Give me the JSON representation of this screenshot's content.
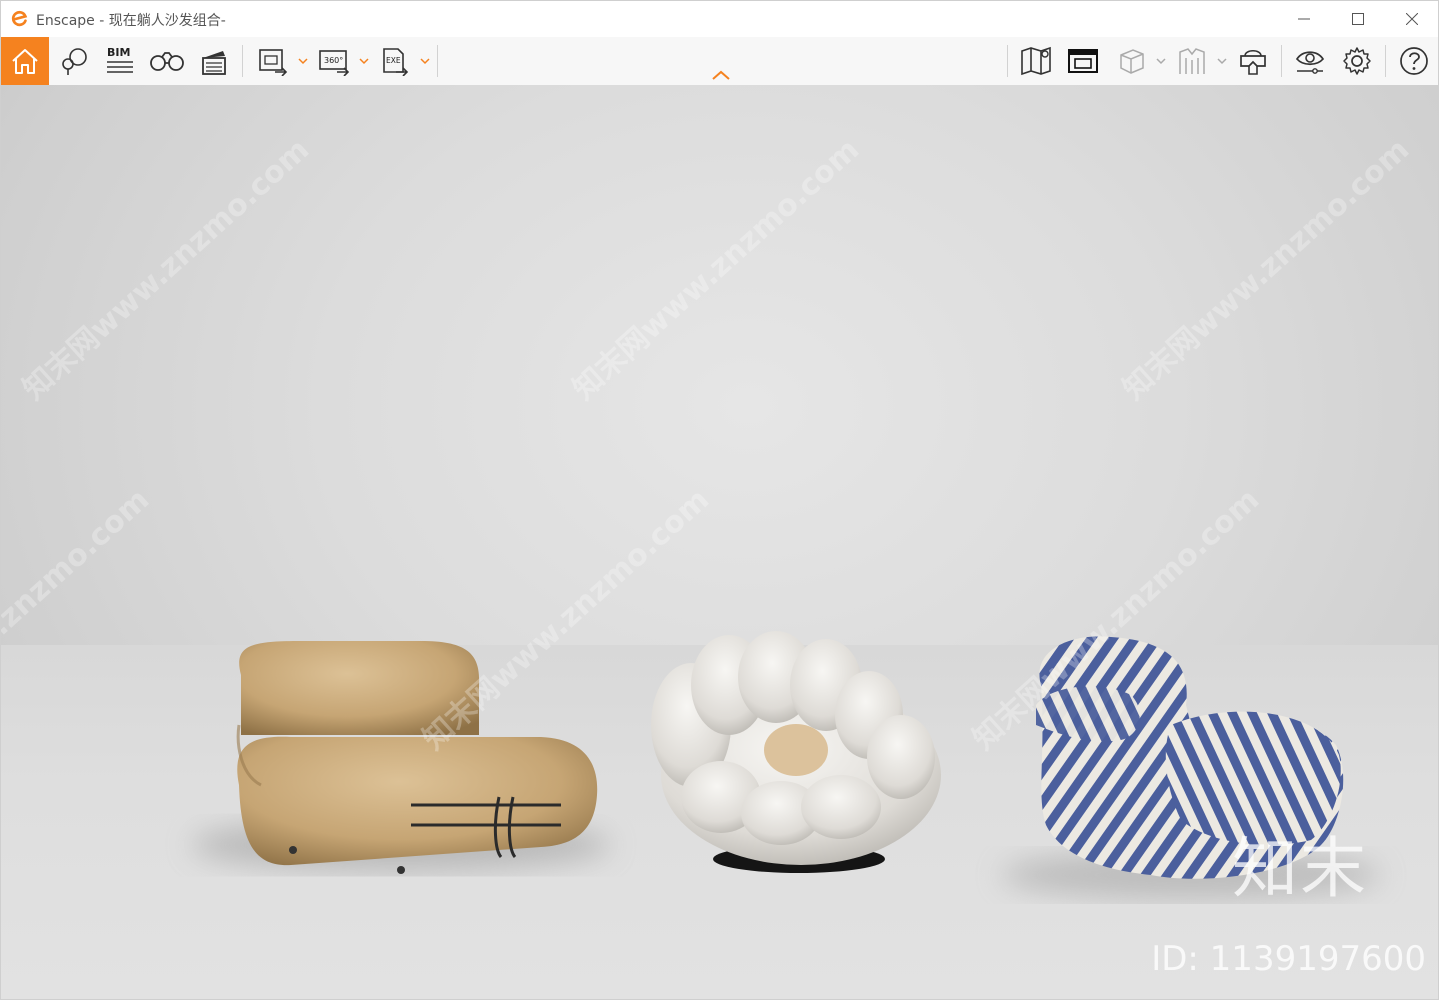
{
  "window": {
    "app_name": "Enscape",
    "title_suffix": " - 现在躺人沙发组合-",
    "accent_color": "#f5821f"
  },
  "window_controls": {
    "minimize_icon": "minimize-icon",
    "maximize_icon": "maximize-icon",
    "close_icon": "close-icon"
  },
  "toolbar": {
    "left_tools": [
      {
        "name": "home",
        "icon": "home-icon",
        "active": true
      },
      {
        "name": "views",
        "icon": "map-pin-icon"
      },
      {
        "name": "bim",
        "label": "BIM",
        "icon": "bim-icon"
      },
      {
        "name": "binoculars",
        "icon": "binoculars-icon"
      },
      {
        "name": "video-editor",
        "icon": "clapperboard-icon"
      },
      {
        "name": "screenshot-export",
        "icon": "image-export-icon"
      },
      {
        "name": "panorama-export",
        "label": "360°",
        "icon": "panorama-export-icon"
      },
      {
        "name": "exe-export",
        "label": "EXE",
        "icon": "exe-export-icon"
      }
    ],
    "right_tools": [
      {
        "name": "map",
        "icon": "map-icon"
      },
      {
        "name": "asset-library",
        "icon": "asset-library-icon"
      },
      {
        "name": "section-box",
        "icon": "cube-icon"
      },
      {
        "name": "material-editor",
        "icon": "material-icon"
      },
      {
        "name": "vr-headset",
        "icon": "vr-headset-icon"
      },
      {
        "name": "visual-settings",
        "icon": "eye-icon"
      },
      {
        "name": "settings",
        "icon": "gear-icon"
      },
      {
        "name": "help",
        "icon": "help-icon"
      }
    ],
    "collapse_icon": "chevron-up-icon"
  },
  "viewport": {
    "scene": "three lounge chairs",
    "watermark_text": "知末网www.znzmo.com",
    "brand_text": "知末",
    "id_text": "ID: 1139197600",
    "chairs": [
      {
        "name": "tan-lounge-chair",
        "color": "#c8a877"
      },
      {
        "name": "white-petal-chair",
        "color": "#e8e6e2"
      },
      {
        "name": "striped-armchair",
        "colors": [
          "#4a5e9c",
          "#ece9e2"
        ]
      }
    ]
  }
}
